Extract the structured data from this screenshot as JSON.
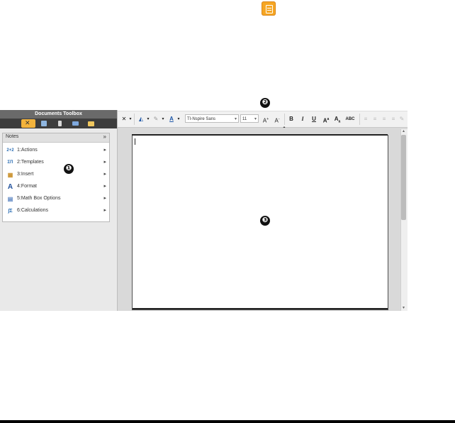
{
  "toolbox": {
    "title": "Documents Toolbox",
    "tabs": [
      {
        "icon": "tools-icon",
        "active": true
      },
      {
        "icon": "page-sorter-icon",
        "active": false
      },
      {
        "icon": "variables-icon",
        "active": false
      },
      {
        "icon": "library-icon",
        "active": false
      },
      {
        "icon": "content-explorer-icon",
        "active": false
      }
    ]
  },
  "notes": {
    "header": "Notes",
    "collapse": "»",
    "items": [
      {
        "icon": "actions-icon",
        "icon_glyph": "2+2",
        "label": "1:Actions"
      },
      {
        "icon": "templates-icon",
        "icon_glyph": "ΣΠ",
        "label": "2:Templates"
      },
      {
        "icon": "insert-icon",
        "icon_glyph": "▦",
        "label": "3:Insert"
      },
      {
        "icon": "format-icon",
        "icon_glyph": "A",
        "label": "4:Format"
      },
      {
        "icon": "math-box-options-icon",
        "icon_glyph": "▤",
        "label": "5:Math Box Options"
      },
      {
        "icon": "calculations-icon",
        "icon_glyph": "∫Σ",
        "label": "6:Calculations"
      }
    ]
  },
  "toolbar": {
    "font_name": "TI-Nspire Sans",
    "font_size": "11",
    "bold": "B",
    "italic": "I",
    "underline": "U",
    "superscript": "A",
    "subscript": "A",
    "strike": "ABC"
  },
  "callouts": {
    "c1": "❶",
    "c2": "❷",
    "c3": "❸"
  },
  "colors": {
    "tab_active": "#f3b33c",
    "toolbox_title_bg": "#6a6a6a",
    "tab_bar_bg": "#3d3d3d"
  }
}
